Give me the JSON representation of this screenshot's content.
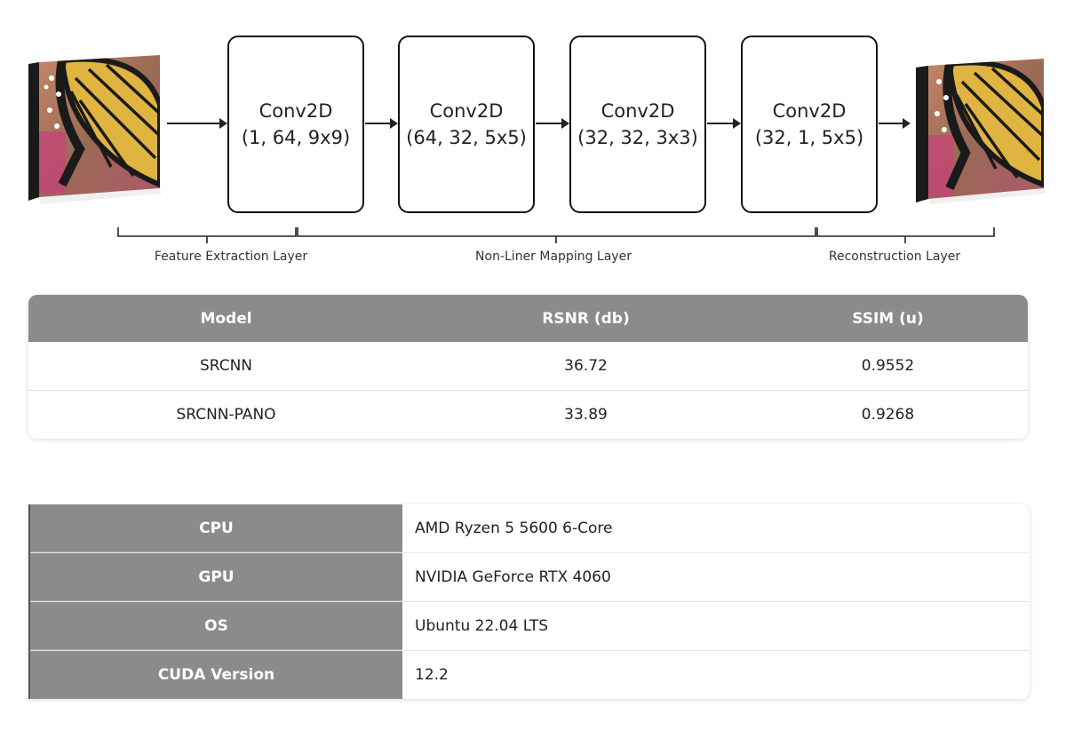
{
  "diagram": {
    "input_image": "butterfly-image",
    "output_image": "butterfly-image",
    "layers": [
      {
        "title": "Conv2D",
        "params": "(1, 64, 9x9)"
      },
      {
        "title": "Conv2D",
        "params": "(64, 32, 5x5)"
      },
      {
        "title": "Conv2D",
        "params": "(32, 32, 3x3)"
      },
      {
        "title": "Conv2D",
        "params": "(32, 1, 5x5)"
      }
    ],
    "stages": [
      {
        "label": "Feature Extraction Layer"
      },
      {
        "label": "Non-Liner Mapping Layer"
      },
      {
        "label": "Reconstruction Layer"
      }
    ]
  },
  "results_table": {
    "header_color": "#8b8b8b",
    "columns": [
      "Model",
      "RSNR (db)",
      "SSIM (u)"
    ],
    "rows": [
      [
        "SRCNN",
        "36.72",
        "0.9552"
      ],
      [
        "SRCNN-PANO",
        "33.89",
        "0.9268"
      ]
    ]
  },
  "specs_table": {
    "rows": [
      {
        "key": "CPU",
        "value": "AMD Ryzen 5 5600 6-Core"
      },
      {
        "key": "GPU",
        "value": "NVIDIA GeForce RTX 4060"
      },
      {
        "key": "OS",
        "value": "Ubuntu 22.04 LTS"
      },
      {
        "key": "CUDA Version",
        "value": "12.2"
      }
    ]
  }
}
